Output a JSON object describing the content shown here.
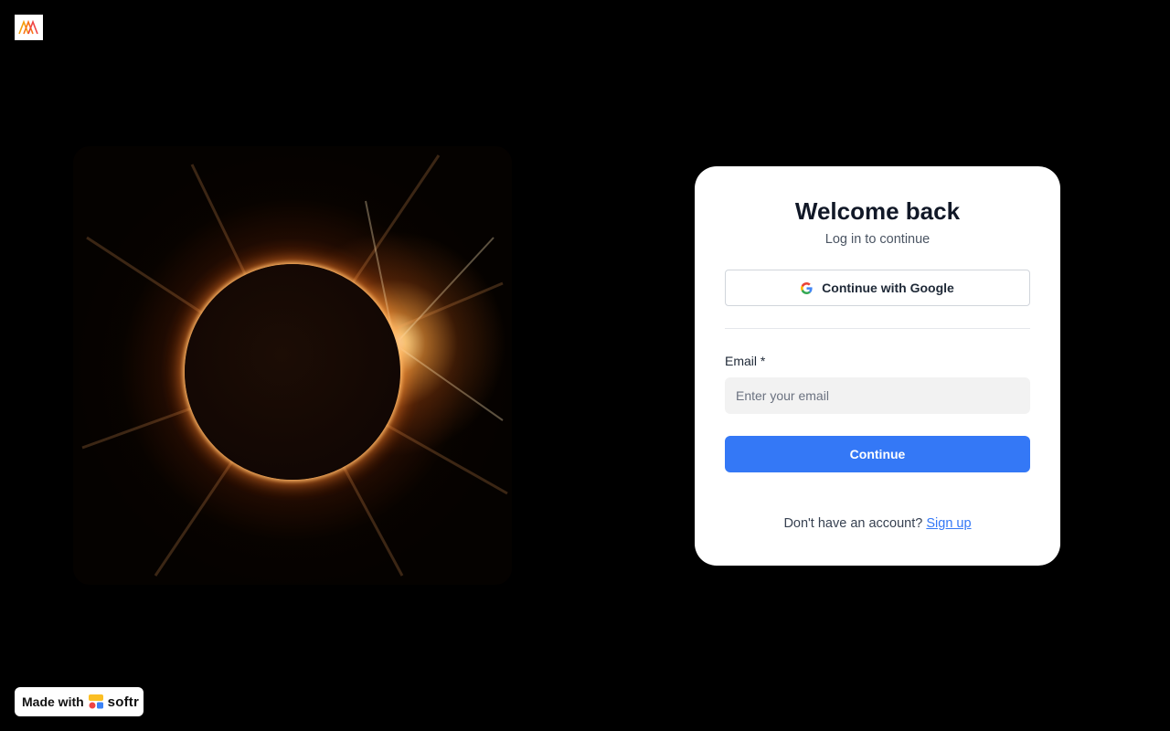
{
  "logo": {
    "icon": "mountains-logo-icon",
    "colors": [
      "#f59e0b",
      "#ef4444"
    ]
  },
  "hero": {
    "image": "solar-eclipse"
  },
  "login": {
    "title": "Welcome back",
    "subtitle": "Log in to continue",
    "google_button": "Continue with Google",
    "email_label": "Email",
    "required_mark": "*",
    "email_placeholder": "Enter your email",
    "continue_button": "Continue",
    "signup_prompt": "Don't have an account?",
    "signup_link": "Sign up"
  },
  "badge": {
    "made_with": "Made with",
    "brand": "softr"
  },
  "colors": {
    "accent": "#3478f6",
    "background": "#000000",
    "card": "#ffffff"
  }
}
